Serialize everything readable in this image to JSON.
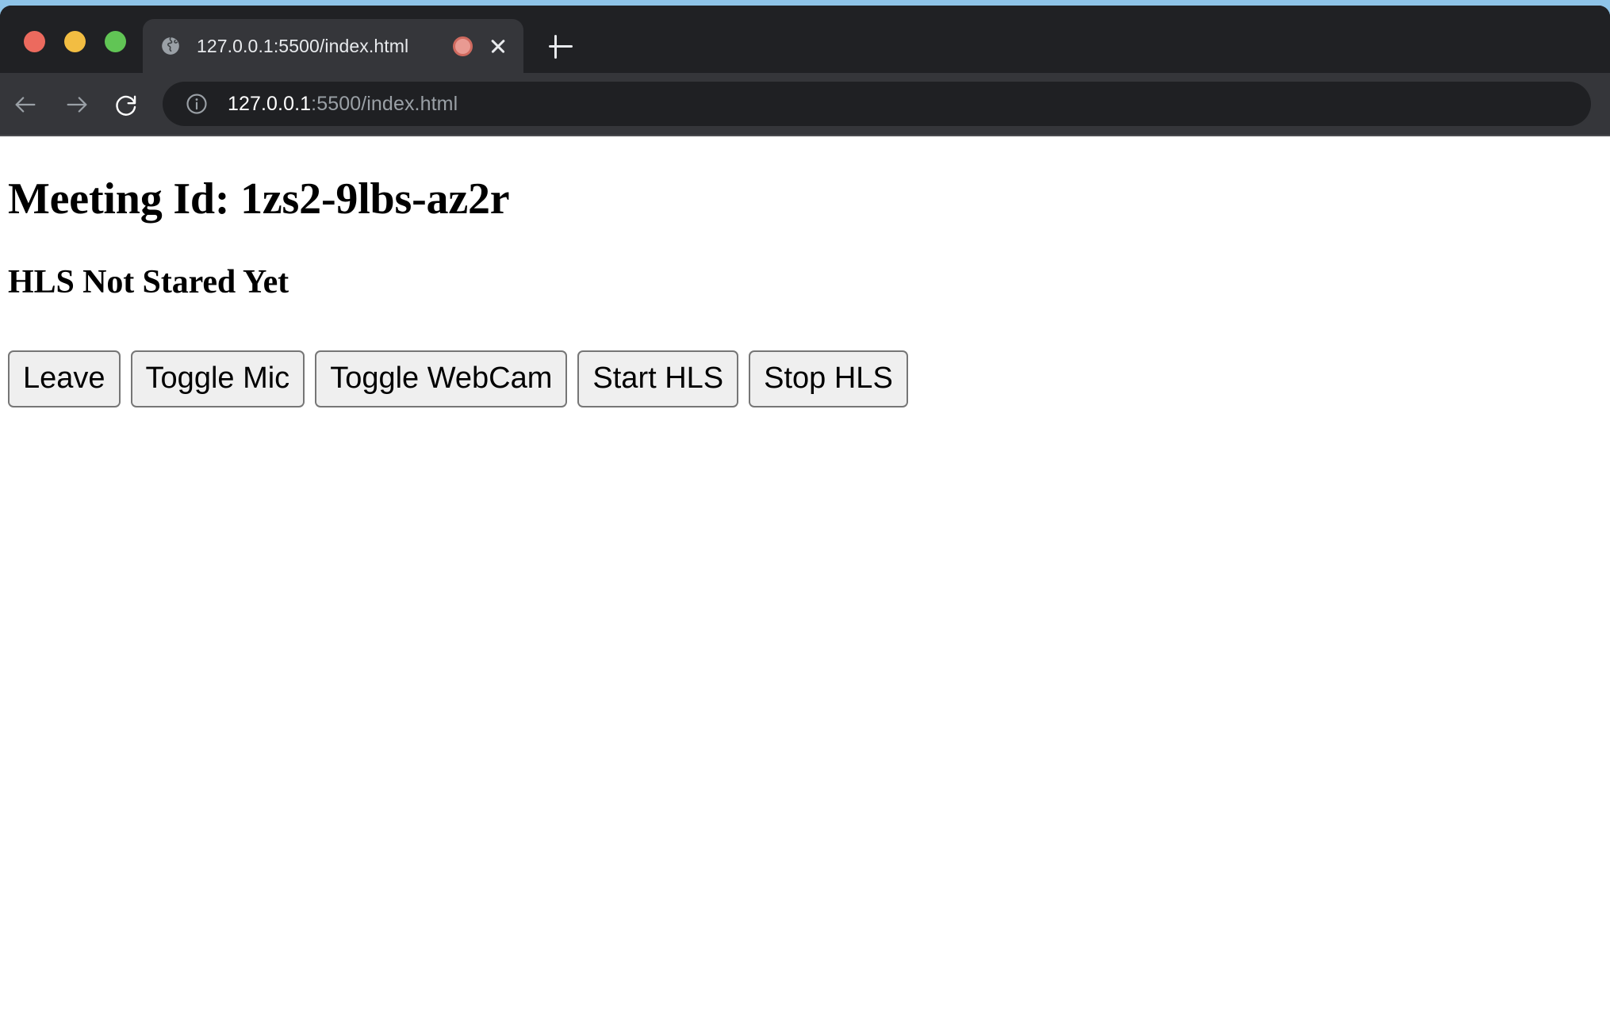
{
  "desktop": {
    "background_color": "#8fc4e8"
  },
  "browser": {
    "window_controls": [
      {
        "name": "close",
        "color": "#ec6a5e"
      },
      {
        "name": "minimize",
        "color": "#f2bd42"
      },
      {
        "name": "maximize",
        "color": "#61c555"
      }
    ],
    "tabs": [
      {
        "title": "127.0.0.1:5500/index.html",
        "favicon": "globe-icon",
        "recording_indicator": "record-dot-icon",
        "active": true
      }
    ],
    "new_tab_label": "+",
    "toolbar": {
      "back_icon": "back-arrow-icon",
      "forward_icon": "forward-arrow-icon",
      "reload_icon": "reload-icon",
      "omnibox": {
        "security_icon": "info-circle-icon",
        "url_host": "127.0.0.1",
        "url_path": ":5500/index.html",
        "full_url": "127.0.0.1:5500/index.html",
        "host_color": "#ffffff",
        "path_color": "#9aa0a6"
      }
    }
  },
  "page": {
    "meeting_heading": "Meeting Id: 1zs2-9lbs-az2r",
    "hls_status_heading": "HLS Not Stared Yet",
    "buttons": [
      {
        "label": "Leave"
      },
      {
        "label": "Toggle Mic"
      },
      {
        "label": "Toggle WebCam"
      },
      {
        "label": "Start HLS"
      },
      {
        "label": "Stop HLS"
      }
    ],
    "background_color": "#ffffff",
    "text_color": "#000000",
    "button_background": "#efefef",
    "button_border": "#767676"
  }
}
